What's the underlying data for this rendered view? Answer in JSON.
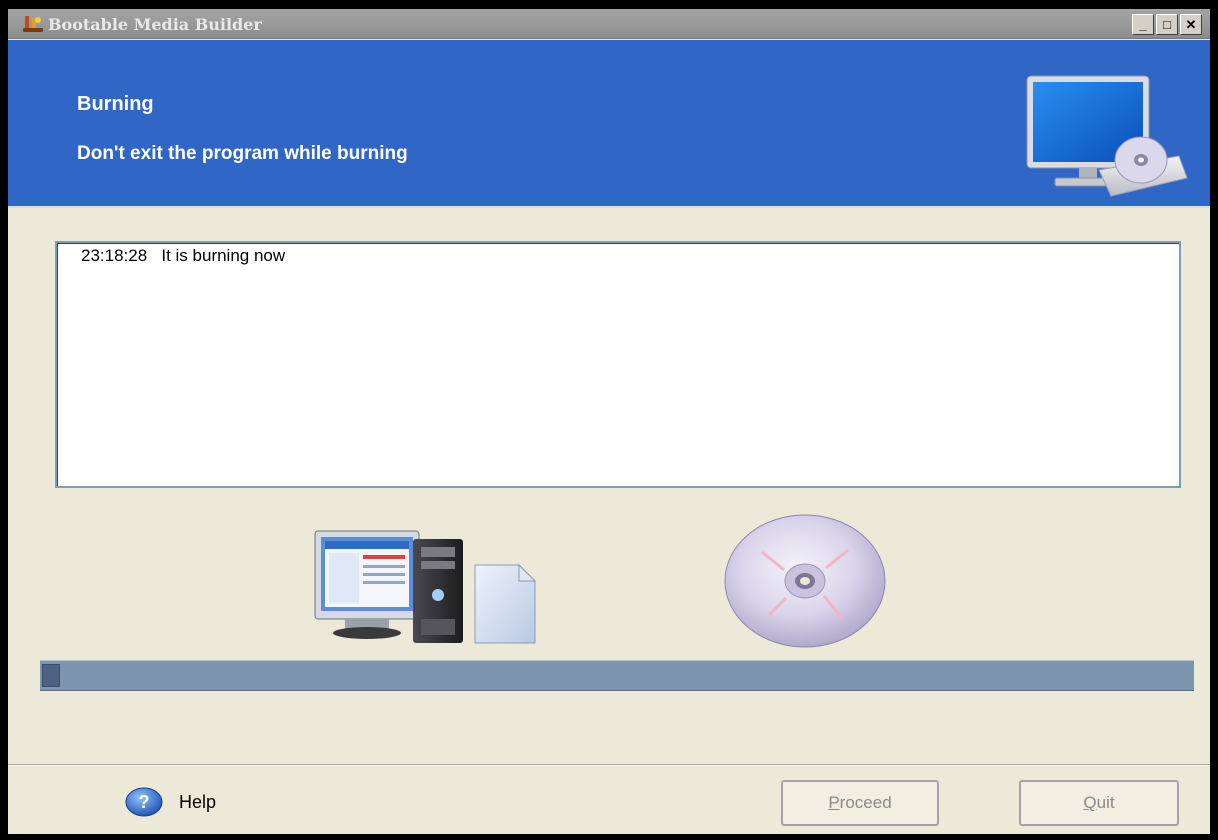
{
  "window": {
    "title": "Bootable Media Builder",
    "controls": {
      "minimize": "_",
      "maximize": "□",
      "close": "✕"
    }
  },
  "banner": {
    "title": "Burning",
    "subtitle": "Don't exit the program while burning",
    "icon": "monitor-disc-icon",
    "color": "#3066c6"
  },
  "log": {
    "entries": [
      {
        "time": "23:18:28",
        "message": "It is burning now"
      }
    ]
  },
  "illustrations": {
    "source": "computer-icon",
    "target": "disc-icon"
  },
  "progress": {
    "fraction": 0.015
  },
  "footer": {
    "help": {
      "label": "Help",
      "icon": "help-icon"
    },
    "proceed": {
      "accel": "P",
      "rest": "roceed",
      "enabled": false
    },
    "quit": {
      "accel": "Q",
      "rest": "uit",
      "enabled": false
    }
  }
}
